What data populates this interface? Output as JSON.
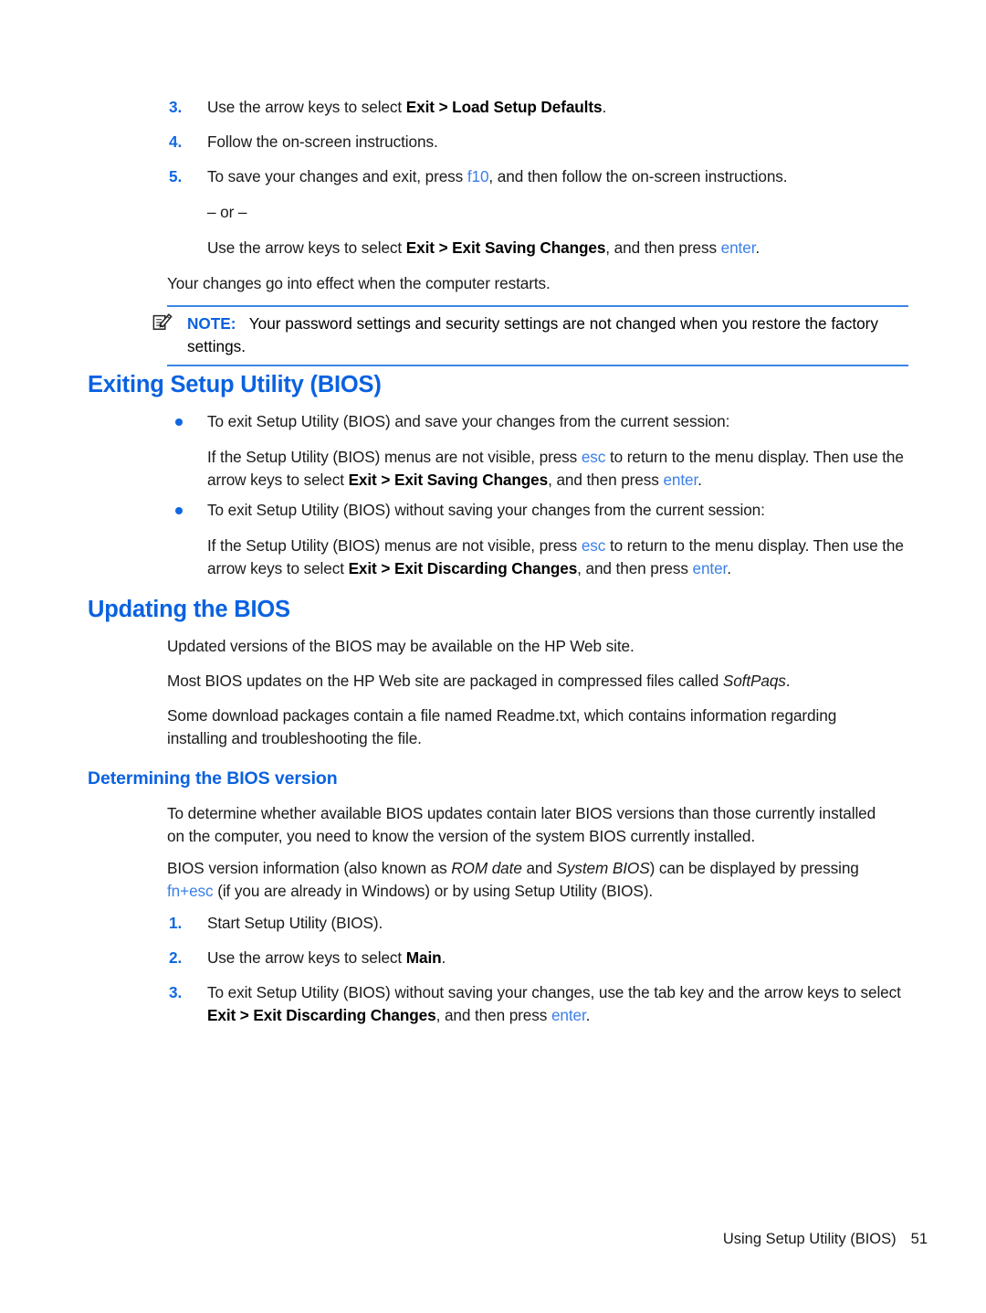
{
  "document": {
    "title": "Using Setup Utility (BIOS)",
    "page_number": "51",
    "footer_text": "Using Setup Utility (BIOS)"
  },
  "colors": {
    "heading_blue": "#0a62e0",
    "key_blue": "#3a7fe8",
    "note_rule_blue": "#3a86e8",
    "marker_blue": "#1068e0",
    "body_black": "#1a1a1a"
  },
  "top_list": {
    "items": [
      {
        "marker": "3.",
        "pre": "Use the arrow keys to select ",
        "bold": "Exit > Load Setup Defaults",
        "post": "."
      },
      {
        "marker": "4.",
        "pre": "Follow the on-screen instructions.",
        "bold": "",
        "post": ""
      },
      {
        "marker": "5.",
        "pre": "To save your changes and exit, press ",
        "key": "f10",
        "post": ", and then follow the on-screen instructions."
      }
    ],
    "or_separator": "– or –",
    "alt_instruction": {
      "pre": "Use the arrow keys to select ",
      "bold": "Exit > Exit Saving Changes",
      "mid": ", and then press ",
      "key": "enter",
      "post": "."
    },
    "effect_text": "Your changes go into effect when the computer restarts."
  },
  "note": {
    "icon": "note-pencil-icon",
    "label": "NOTE:",
    "text": "Your password settings and security settings are not changed when you restore the factory settings."
  },
  "exiting_section": {
    "heading": "Exiting Setup Utility (BIOS)",
    "bullets": [
      {
        "lead": "To exit Setup Utility (BIOS) and save your changes from the current session:",
        "detail_pre": "If the Setup Utility (BIOS) menus are not visible, press ",
        "detail_key1": "esc",
        "detail_mid1": " to return to the menu display. Then use the arrow keys to select ",
        "detail_bold": "Exit > Exit Saving Changes",
        "detail_mid2": ", and then press ",
        "detail_key2": "enter",
        "detail_post": "."
      },
      {
        "lead": "To exit Setup Utility (BIOS) without saving your changes from the current session:",
        "detail_pre": "If the Setup Utility (BIOS) menus are not visible, press ",
        "detail_key1": "esc",
        "detail_mid1": " to return to the menu display. Then use the arrow keys to select ",
        "detail_bold": "Exit > Exit Discarding Changes",
        "detail_mid2": ", and then press ",
        "detail_key2": "enter",
        "detail_post": "."
      }
    ]
  },
  "updating_section": {
    "heading": "Updating the BIOS",
    "paragraph_1": "Updated versions of the BIOS may be available on the HP Web site.",
    "paragraph_2_pre": "Most BIOS updates on the HP Web site are packaged in compressed files called ",
    "paragraph_2_italic": "SoftPaqs",
    "paragraph_2_post": ".",
    "paragraph_3": "Some download packages contain a file named Readme.txt, which contains information regarding installing and troubleshooting the file."
  },
  "determining_section": {
    "heading": "Determining the BIOS version",
    "paragraph_1": "To determine whether available BIOS updates contain later BIOS versions than those currently installed on the computer, you need to know the version of the system BIOS currently installed.",
    "paragraph_2_pre": "BIOS version information (also known as ",
    "paragraph_2_italic_1": "ROM date",
    "paragraph_2_mid": " and ",
    "paragraph_2_italic_2": "System BIOS",
    "paragraph_2_post_pre": ") can be displayed by pressing ",
    "paragraph_2_key": "fn+esc",
    "paragraph_2_post": " (if you are already in Windows) or by using Setup Utility (BIOS).",
    "steps": [
      {
        "marker": "1.",
        "pre": "Start Setup Utility (BIOS).",
        "bold": "",
        "post": ""
      },
      {
        "marker": "2.",
        "pre": "Use the arrow keys to select ",
        "bold": "Main",
        "post": "."
      },
      {
        "marker": "3.",
        "pre": "To exit Setup Utility (BIOS) without saving your changes, use the tab key and the arrow keys to select ",
        "bold": "Exit > Exit Discarding Changes",
        "mid": ", and then press ",
        "key": "enter",
        "post": "."
      }
    ]
  }
}
